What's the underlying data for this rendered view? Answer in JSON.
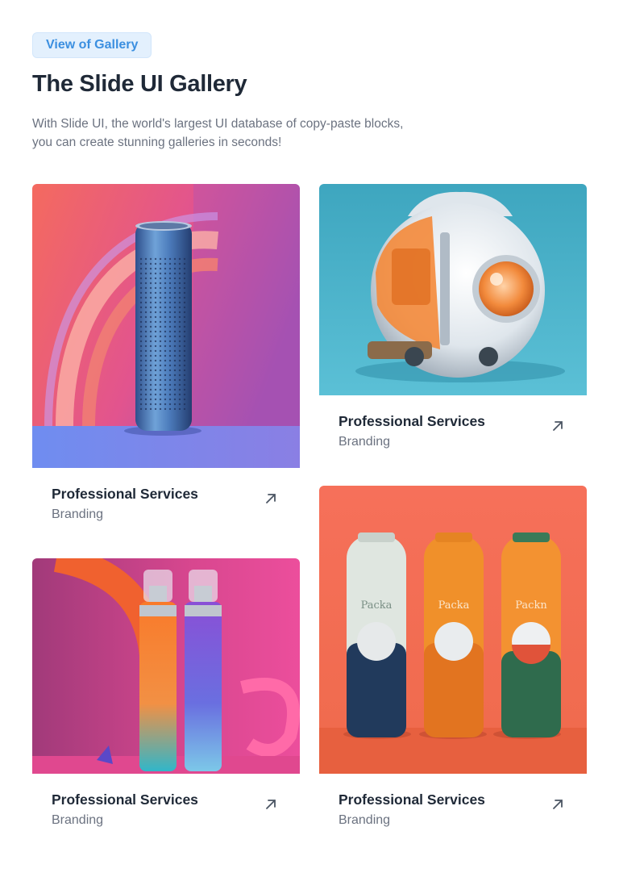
{
  "header": {
    "badge": "View of Gallery",
    "title": "The Slide UI Gallery",
    "subtitle": "With Slide UI, the world's largest UI database of copy-paste blocks, you can create stunning galleries in seconds!"
  },
  "cards": [
    {
      "title": "Professional Services",
      "category": "Branding",
      "image": "blue-speaker-cylinder"
    },
    {
      "title": "Professional Services",
      "category": "Branding",
      "image": "orange-white-robot-helmet"
    },
    {
      "title": "Professional Services",
      "category": "Branding",
      "image": "spray-bottles-pink-background"
    },
    {
      "title": "Professional Services",
      "category": "Branding",
      "image": "three-packa-bottles"
    }
  ],
  "product_labels": [
    "Packa",
    "Packa",
    "Packn"
  ],
  "icons": {
    "card_link": "arrow-up-right-icon"
  },
  "colors": {
    "accent": "#3b8fe0",
    "badge_bg": "#e3f0fd",
    "heading": "#1f2937",
    "muted": "#6b7280"
  }
}
